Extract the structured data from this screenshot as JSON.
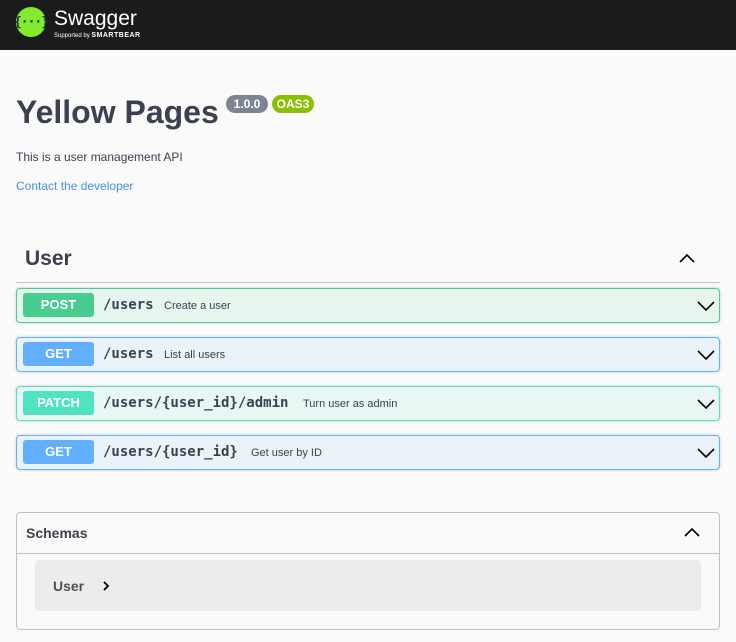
{
  "topbar": {
    "logo_mark": "{···}",
    "brand": "Swagger",
    "supported_by": "Supported by",
    "sponsor": "SMARTBEAR"
  },
  "info": {
    "title": "Yellow Pages",
    "version": "1.0.0",
    "spec": "OAS3",
    "description": "This is a user management API",
    "contact_label": "Contact the developer"
  },
  "tag": {
    "name": "User",
    "expanded": true
  },
  "operations": [
    {
      "method": "POST",
      "path": "/users",
      "summary": "Create a user",
      "color": "#49cc90"
    },
    {
      "method": "GET",
      "path": "/users",
      "summary": "List all users",
      "color": "#61affe"
    },
    {
      "method": "PATCH",
      "path": "/users/{user_id}/admin",
      "summary": "Turn user as admin",
      "color": "#50e3c2"
    },
    {
      "method": "GET",
      "path": "/users/{user_id}",
      "summary": "Get user by ID",
      "color": "#61affe"
    }
  ],
  "schemas": {
    "title": "Schemas",
    "expanded": true,
    "models": [
      {
        "name": "User"
      }
    ]
  },
  "colors": {
    "topbar": "#1b1b1b",
    "logo": "#85ea2d",
    "link": "#4990e2",
    "version_badge": "#7d8492",
    "oas_badge": "#89bf04"
  },
  "icons": {
    "logo": "swagger-logo-icon",
    "collapse": "chevron-up-icon",
    "expand": "chevron-down-icon",
    "model_expand": "chevron-right-icon"
  }
}
